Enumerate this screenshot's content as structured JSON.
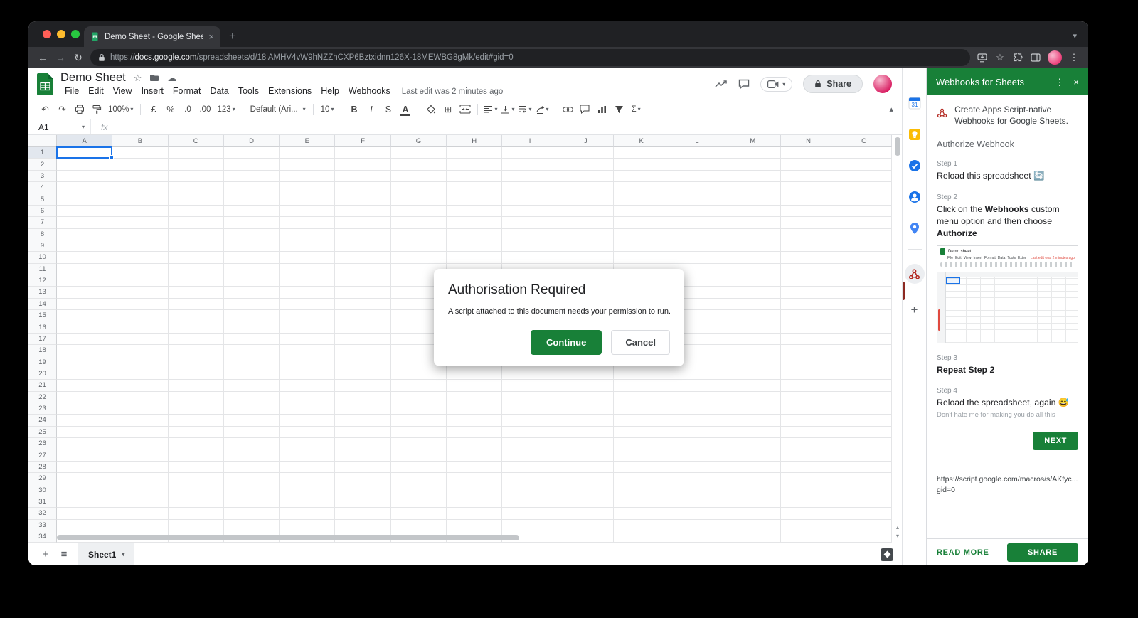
{
  "colors": {
    "tab_dark": "#202124",
    "toolbar_dark": "#35363a",
    "brand_green": "#188038",
    "dialog_green": "#188038",
    "selection_blue": "#1a73e8"
  },
  "icons": {
    "undo": "↶",
    "redo": "↷",
    "borders": "⊞",
    "sum": "Σ",
    "dropdown": "▾",
    "collapse": "▴",
    "overflow": "⋮",
    "close": "×",
    "new_tab": "+",
    "tab_search": "▾",
    "back": "←",
    "forward": "→",
    "reload": "↻",
    "star": "☆",
    "cloud": "☁",
    "fx": "fx",
    "all_sheets": "≡",
    "add_sheet": "+",
    "add_addon": "+",
    "calendar_day": "31",
    "scroll_up": "▴",
    "scroll_down": "▾"
  },
  "browser": {
    "tab_title": "Demo Sheet - Google Sheets",
    "url_scheme": "https://",
    "url_domain": "docs.google.com",
    "url_path": "/spreadsheets/d/18iAMHV4vW9hNZZhCXP6Bztxidnn126X-18MEWBG8gMk/edit#gid=0"
  },
  "sheets": {
    "title": "Demo Sheet",
    "menus": [
      "File",
      "Edit",
      "View",
      "Insert",
      "Format",
      "Data",
      "Tools",
      "Extensions",
      "Help",
      "Webhooks"
    ],
    "last_edit": "Last edit was 2 minutes ago",
    "share_label": "Share",
    "toolbar": {
      "zoom": "100%",
      "currency": "£",
      "percent": "%",
      "decrease_decimal": ".0",
      "increase_decimal": ".00",
      "more_formats": "123",
      "font": "Default (Ari...",
      "font_size": "10",
      "bold": "B",
      "italic": "I",
      "strikethrough": "S",
      "text_color": "A"
    },
    "name_box": "A1",
    "columns": [
      "A",
      "B",
      "C",
      "D",
      "E",
      "F",
      "G",
      "H",
      "I",
      "J",
      "K",
      "L",
      "M",
      "N",
      "O"
    ],
    "row_count": 34,
    "selected_cell": "A1",
    "selected_col": "A",
    "selected_row": 1,
    "sheet_tab": "Sheet1"
  },
  "dialog": {
    "title": "Authorisation Required",
    "message": "A script attached to this document needs your permission to run.",
    "continue_label": "Continue",
    "cancel_label": "Cancel"
  },
  "sidebar": {
    "title": "Webhooks for Sheets",
    "intro": "Create Apps Script-native Webhooks for Google Sheets.",
    "section": "Authorize Webhook",
    "steps": {
      "s1": {
        "label": "Step 1",
        "text": "Reload this spreadsheet 🔄"
      },
      "s2": {
        "label": "Step 2",
        "pre": "Click on the ",
        "bold1": "Webhooks",
        "mid": " custom menu option and then choose ",
        "bold2": "Authorize"
      },
      "s3": {
        "label": "Step 3",
        "text": "Repeat Step 2"
      },
      "s4": {
        "label": "Step 4",
        "text": "Reload the spreadsheet, again 😅",
        "note": "Don't hate me for making you do all this"
      }
    },
    "next_label": "NEXT",
    "url_line1": "https://script.google.com/macros/s/AKfyc...",
    "url_line2": "gid=0",
    "read_more_label": "READ MORE",
    "share_label": "SHARE",
    "thumb_title": "Demo sheet"
  }
}
